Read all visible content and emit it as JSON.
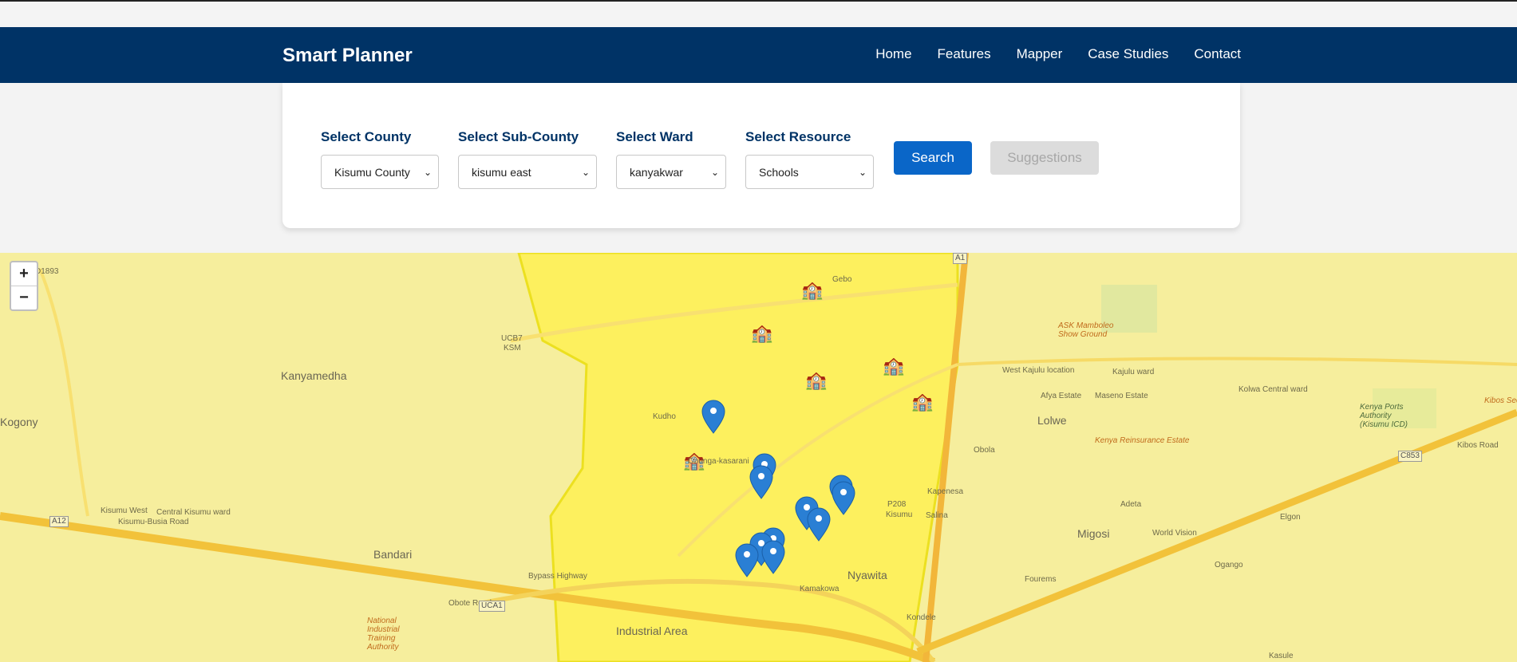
{
  "nav": {
    "brand": "Smart Planner",
    "links": [
      "Home",
      "Features",
      "Mapper",
      "Case Studies",
      "Contact"
    ]
  },
  "filters": {
    "county": {
      "label": "Select County",
      "value": "Kisumu County"
    },
    "subcounty": {
      "label": "Select Sub-County",
      "value": "kisumu east"
    },
    "ward": {
      "label": "Select Ward",
      "value": "kanyakwar"
    },
    "resource": {
      "label": "Select Resource",
      "value": "Schools"
    },
    "search_label": "Search",
    "suggestions_label": "Suggestions"
  },
  "map": {
    "zoom_in": "+",
    "zoom_out": "−",
    "labels": {
      "d1893": "D1893",
      "kogony": "Kogony",
      "kanyamedha": "Kanyamedha",
      "bandari": "Bandari",
      "ucb7": "UCB7",
      "ksm": "KSM",
      "gebo": "Gebo",
      "kudho": "Kudho",
      "obunga": "Obunga-kasarani",
      "nyawita": "Nyawita",
      "kamakowa": "Kamakowa",
      "industrial": "Industrial Area",
      "bypass": "Bypass Highway",
      "obote": "Obote Road",
      "kisumu_busia": "Kisumu-Busia Road",
      "kisumu_west": "Kisumu West",
      "central_ward": "Central Kisumu ward",
      "a12": "A12",
      "a1": "A1",
      "p208": "P208",
      "kisumu": "Kisumu",
      "salina": "Salina",
      "kapenesa": "Kapenesa",
      "obola": "Obola",
      "lolwe": "Lolwe",
      "afya": "Afya Estate",
      "maseno": "Maseno Estate",
      "migosi": "Migosi",
      "adeta": "Adeta",
      "world_vision": "World Vision",
      "ogango": "Ogango",
      "elgon": "Elgon",
      "kenya_re": "Kenya Reinsurance Estate",
      "west_kajulu": "West Kajulu location",
      "kajulu_ward": "Kajulu ward",
      "kolwa": "Kolwa Central ward",
      "kibos_road": "Kibos Road",
      "c853": "C853",
      "kibos_sec": "Kibos Secondary School",
      "kenya_ports": "Kenya Ports Authority (Kisumu ICD)",
      "mamboleo": "ASK Mamboleo Show Ground",
      "uca1": "UCA1",
      "national_iti": "National Industrial Training Authority",
      "kondele": "Kondele",
      "fourems": "Fourems",
      "kasule": "Kasule"
    }
  }
}
